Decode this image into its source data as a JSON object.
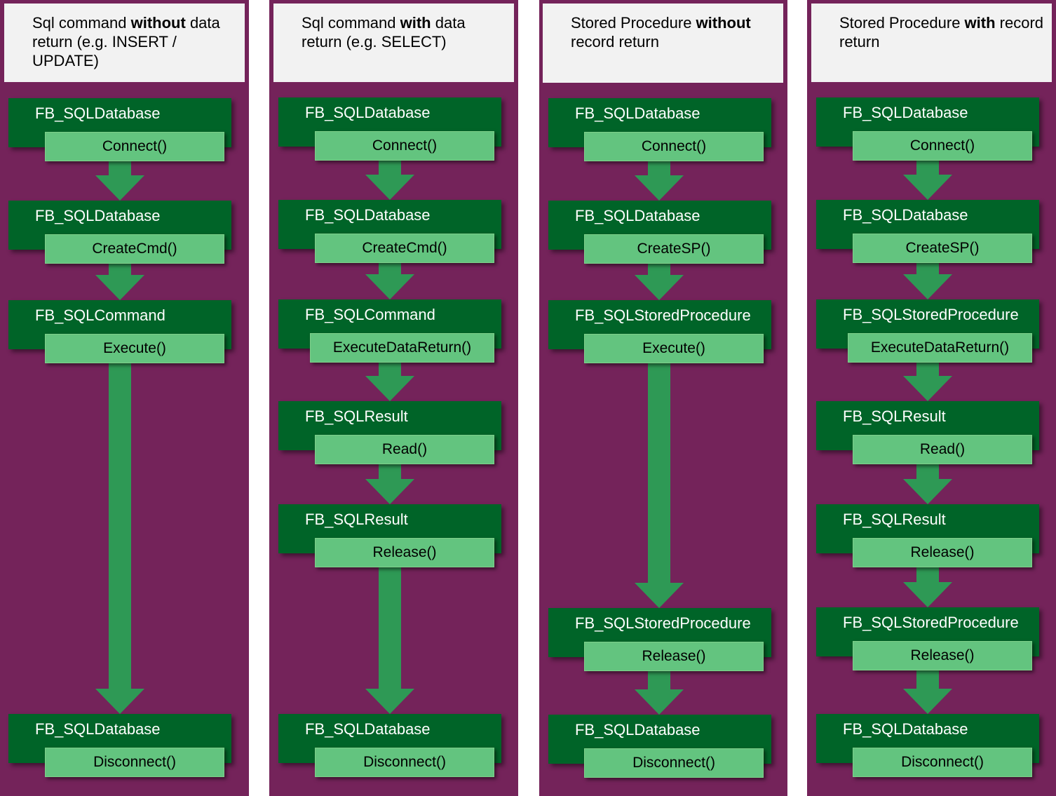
{
  "colors": {
    "background": "#74235a",
    "header_bg": "#f2f2f2",
    "class_box": "#006428",
    "method_box": "#63c47f",
    "arrow": "#2e9955"
  },
  "columns": [
    {
      "header": {
        "pre": "Sql command ",
        "bold": "without",
        "post": " data return (e.g. INSERT / UPDATE)"
      },
      "steps": [
        {
          "class": "FB_SQLDatabase",
          "method": "Connect()"
        },
        {
          "class": "FB_SQLDatabase",
          "method": "CreateCmd()"
        },
        {
          "class": "FB_SQLCommand",
          "method": "Execute()"
        },
        {
          "class": "FB_SQLDatabase",
          "method": "Disconnect()"
        }
      ]
    },
    {
      "header": {
        "pre": "Sql command ",
        "bold": "with",
        "post": " data return (e.g. SELECT)"
      },
      "steps": [
        {
          "class": "FB_SQLDatabase",
          "method": "Connect()"
        },
        {
          "class": "FB_SQLDatabase",
          "method": "CreateCmd()"
        },
        {
          "class": "FB_SQLCommand",
          "method": "ExecuteDataReturn()"
        },
        {
          "class": "FB_SQLResult",
          "method": "Read()"
        },
        {
          "class": "FB_SQLResult",
          "method": "Release()"
        },
        {
          "class": "FB_SQLDatabase",
          "method": "Disconnect()"
        }
      ]
    },
    {
      "header": {
        "pre": "Stored Procedure ",
        "bold": "without",
        "post": " record return"
      },
      "steps": [
        {
          "class": "FB_SQLDatabase",
          "method": "Connect()"
        },
        {
          "class": "FB_SQLDatabase",
          "method": "CreateSP()"
        },
        {
          "class": "FB_SQLStoredProcedure",
          "method": "Execute()"
        },
        {
          "class": "FB_SQLStoredProcedure",
          "method": "Release()"
        },
        {
          "class": "FB_SQLDatabase",
          "method": "Disconnect()"
        }
      ]
    },
    {
      "header": {
        "pre": "Stored Procedure ",
        "bold": "with",
        "post": " record return"
      },
      "steps": [
        {
          "class": "FB_SQLDatabase",
          "method": "Connect()"
        },
        {
          "class": "FB_SQLDatabase",
          "method": "CreateSP()"
        },
        {
          "class": "FB_SQLStoredProcedure",
          "method": "ExecuteDataReturn()"
        },
        {
          "class": "FB_SQLResult",
          "method": "Read()"
        },
        {
          "class": "FB_SQLResult",
          "method": "Release()"
        },
        {
          "class": "FB_SQLStoredProcedure",
          "method": "Release()"
        },
        {
          "class": "FB_SQLDatabase",
          "method": "Disconnect()"
        }
      ]
    }
  ]
}
